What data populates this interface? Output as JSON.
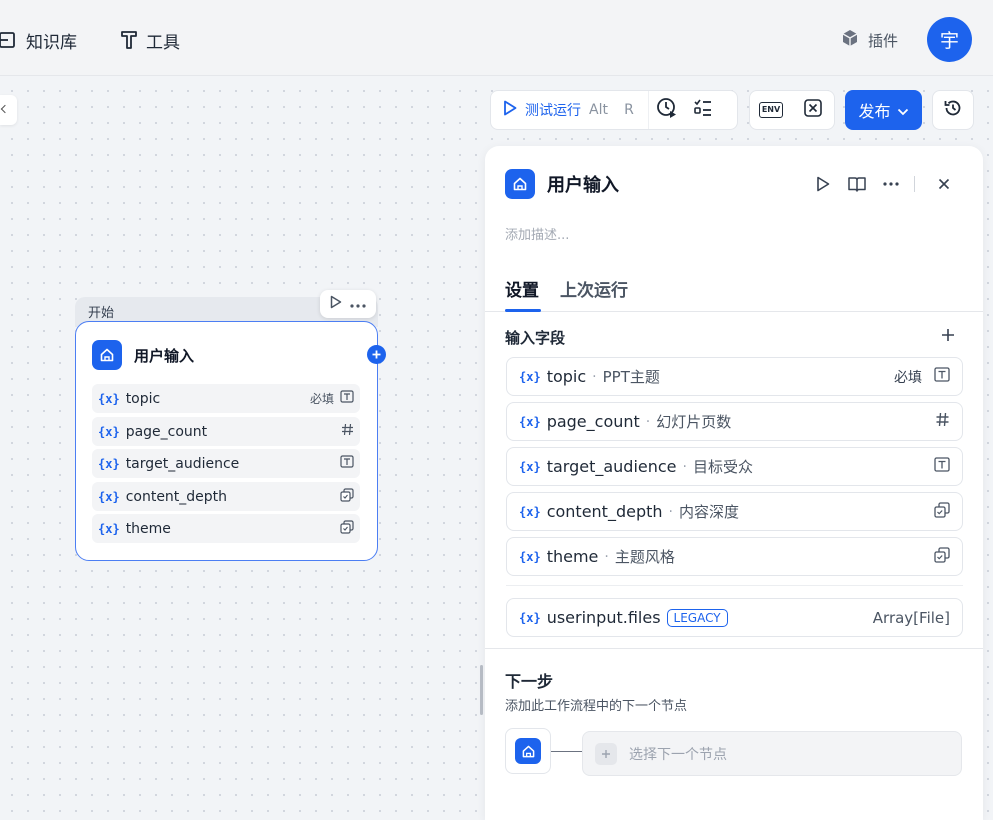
{
  "topbar": {
    "nav": [
      {
        "label": "知识库",
        "icon": "book-icon"
      },
      {
        "label": "工具",
        "icon": "tool-icon"
      }
    ],
    "plugin_label": "插件",
    "avatar_text": "宇"
  },
  "toolbar": {
    "test_run_label": "测试运行",
    "shortcut_mod": "Alt",
    "shortcut_key": "R",
    "env_icon_text": "ENV",
    "publish_label": "发布"
  },
  "node": {
    "header_label": "开始",
    "title": "用户输入",
    "var_prefix": "{x}",
    "required_label": "必填",
    "rows": [
      {
        "name": "topic",
        "required": true,
        "type": "text"
      },
      {
        "name": "page_count",
        "required": false,
        "type": "number"
      },
      {
        "name": "target_audience",
        "required": false,
        "type": "text"
      },
      {
        "name": "content_depth",
        "required": false,
        "type": "select"
      },
      {
        "name": "theme",
        "required": false,
        "type": "select"
      }
    ]
  },
  "panel": {
    "title": "用户输入",
    "desc_placeholder": "添加描述...",
    "tabs": [
      {
        "label": "设置",
        "active": true
      },
      {
        "label": "上次运行",
        "active": false
      }
    ],
    "fields_title": "输入字段",
    "var_prefix": "{x}",
    "required_label": "必填",
    "fields": [
      {
        "name": "topic",
        "desc": "PPT主题",
        "required": true,
        "type": "text"
      },
      {
        "name": "page_count",
        "desc": "幻灯片页数",
        "required": false,
        "type": "number"
      },
      {
        "name": "target_audience",
        "desc": "目标受众",
        "required": false,
        "type": "text"
      },
      {
        "name": "content_depth",
        "desc": "内容深度",
        "required": false,
        "type": "select"
      },
      {
        "name": "theme",
        "desc": "主题风格",
        "required": false,
        "type": "select"
      }
    ],
    "system_field": {
      "name": "userinput.files",
      "tag": "LEGACY",
      "type_text": "Array[File]"
    },
    "next_title": "下一步",
    "next_desc": "添加此工作流程中的下一个节点",
    "next_select_placeholder": "选择下一个节点"
  },
  "colors": {
    "accent": "#1d63ed",
    "canvas": "#f2f4f7"
  }
}
